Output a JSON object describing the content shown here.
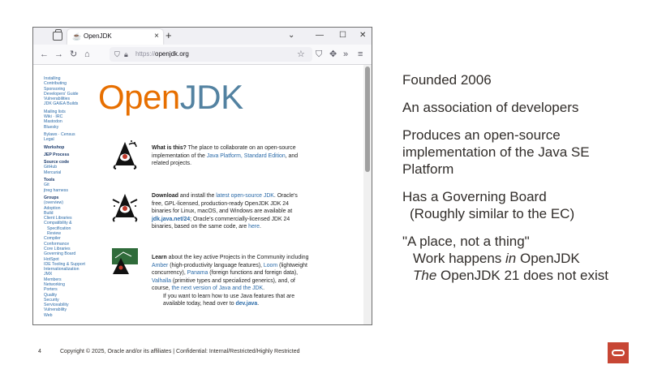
{
  "browser": {
    "tab_title": "OpenJDK",
    "tab_close": "×",
    "new_tab": "+",
    "win_minimize": "—",
    "win_maximize": "☐",
    "win_close": "✕",
    "win_chevron": "⌄",
    "url_scheme": "https://",
    "url_host": "openjdk.org",
    "nav_back": "←",
    "nav_forward": "→",
    "nav_reload": "↻",
    "nav_home": "⌂",
    "toolbar_star": "☆",
    "toolbar_more": "»",
    "toolbar_menu": "≡"
  },
  "sidebar": {
    "groups": [
      [
        "Installing",
        "Contributing",
        "Sponsoring",
        "Developers' Guide",
        "Vulnerabilities",
        "JDK GA/EA Builds"
      ],
      [
        "Mailing lists",
        "Wiki · IRC",
        "Mastodon",
        "Bluesky"
      ],
      [
        "Bylaws · Census",
        "Legal"
      ],
      [
        "Workshop"
      ],
      [
        "JEP Process"
      ],
      [
        "Source code",
        "GitHub",
        "Mercurial"
      ],
      [
        "Tools",
        "Git",
        "jtreg harness"
      ],
      [
        "Groups",
        "(overview)",
        "Adoption",
        "Build",
        "Client Libraries",
        "Compatibility &",
        "Specification",
        "Review",
        "Compiler",
        "Conformance",
        "Core Libraries",
        "Governing Board",
        "HotSpot",
        "IDE Tooling & Support",
        "Internationalization",
        "JMX",
        "Members",
        "Networking",
        "Porters",
        "Quality",
        "Security",
        "Serviceability",
        "Vulnerability",
        "Web"
      ]
    ]
  },
  "logo": {
    "open": "Open",
    "jdk": "JDK"
  },
  "content": {
    "what": {
      "heading": "What is this?",
      "text1": " The place to collaborate on an open-source implementation of the ",
      "link1": "Java Platform, Standard Edition",
      "text2": ", and related projects."
    },
    "download": {
      "heading": "Download",
      "text1": " and install the ",
      "link1": "latest open-source JDK",
      "text2": ". Oracle's free, GPL-licensed, production-ready OpenJDK JDK 24 binaries for Linux, macOS, and Windows are available at ",
      "link2": "jdk.java.net/24",
      "text3": "; Oracle's commercially-licensed JDK 24 binaries, based on the same code, are ",
      "link3": "here",
      "text4": "."
    },
    "learn": {
      "heading": "Learn",
      "text1": " about the key active Projects in the Community including ",
      "link1": "Amber",
      "text2": " (high-productivity language features), ",
      "link2": "Loom",
      "text3": " (lightweight concurrency), ",
      "link3": "Panama",
      "text4": " (foreign functions and foreign data), ",
      "link4": "Valhalla",
      "text5": " (primitive types and specialized generics), and, of course, ",
      "link5": "the next version of Java and the JDK",
      "text6": ".",
      "text7": "If you want to learn how to use Java features that are available today, head over to ",
      "link6": "dev.java",
      "text8": "."
    }
  },
  "slide": {
    "bullet1": "Founded 2006",
    "bullet2": "An association of developers",
    "bullet3_lines": [
      "Produces an open-source",
      "implementation of the Java SE",
      "Platform"
    ],
    "bullet4_line1": "Has a Governing Board",
    "bullet4_line2": "(Roughly similar to the EC)",
    "bullet5_line1": "\"A place, not a thing\"",
    "bullet5_line2_pre": "Work happens ",
    "bullet5_line2_em": "in",
    "bullet5_line2_post": " OpenJDK",
    "bullet5_line3_em": "The",
    "bullet5_line3_post": " OpenJDK 21 does not exist"
  },
  "footer": {
    "page_number": "4",
    "copyright": "Copyright © 2025, Oracle and/or its affiliates  |  Confidential: Internal/Restricted/Highly Restricted"
  },
  "colors": {
    "open": "#e76f00",
    "jdk": "#5382a1",
    "link": "#2a6aa8",
    "oracle_red": "#c74634"
  }
}
